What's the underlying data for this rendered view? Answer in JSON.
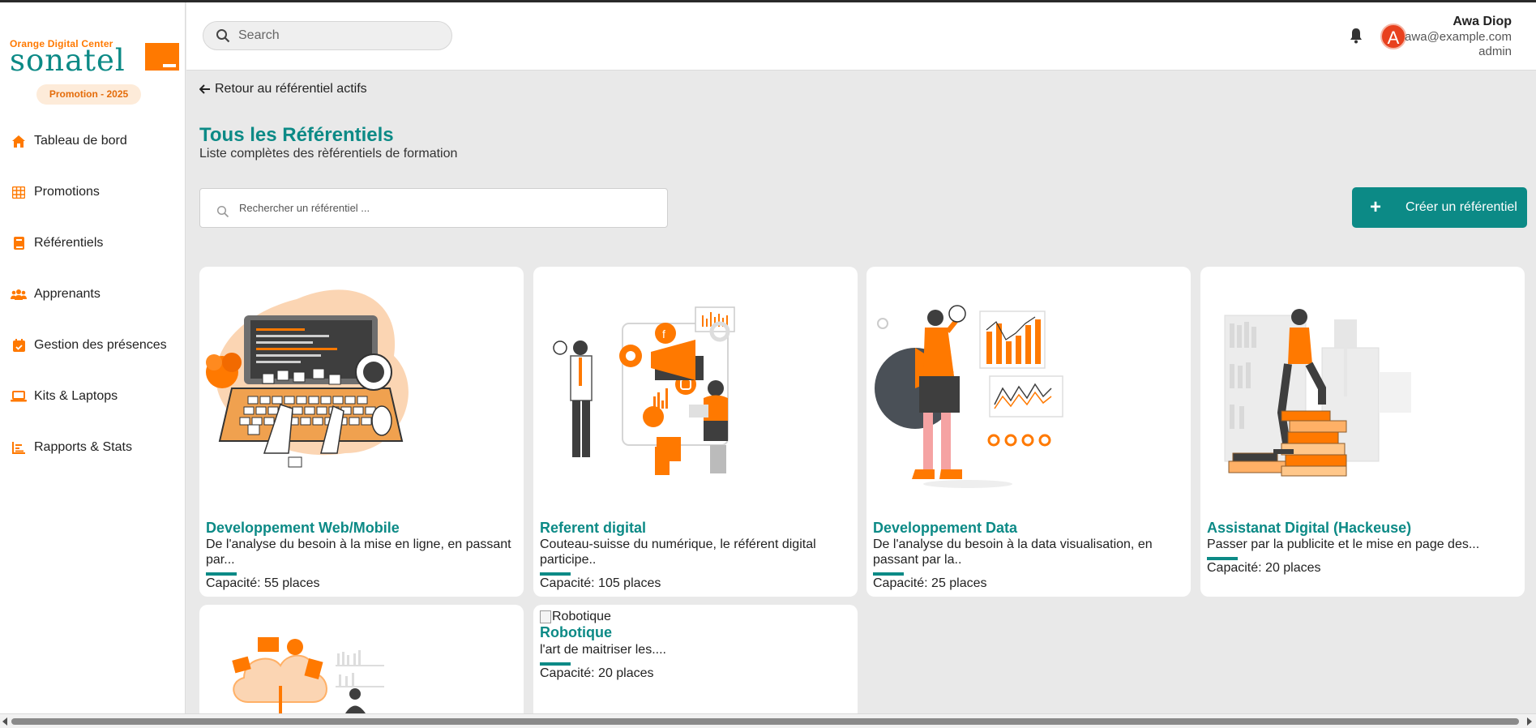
{
  "brand": {
    "top_text": "Orange Digital Center",
    "main_text": "sonatel",
    "accent": "#ff7900",
    "teal": "#0c8a86"
  },
  "sidebar": {
    "promotion_badge": "Promotion - 2025",
    "items": [
      {
        "label": "Tableau de bord",
        "icon": "home-icon"
      },
      {
        "label": "Promotions",
        "icon": "grid-icon"
      },
      {
        "label": "Référentiels",
        "icon": "book-icon"
      },
      {
        "label": "Apprenants",
        "icon": "users-icon"
      },
      {
        "label": "Gestion des présences",
        "icon": "calendar-check-icon"
      },
      {
        "label": "Kits & Laptops",
        "icon": "laptop-icon"
      },
      {
        "label": "Rapports & Stats",
        "icon": "bar-chart-icon"
      }
    ]
  },
  "header": {
    "search_placeholder": "Search",
    "user": {
      "avatar_letter": "A",
      "name": "Awa Diop",
      "email": "awa@example.com",
      "role": "admin"
    }
  },
  "main": {
    "back_link": "Retour au référentiel actifs",
    "title": "Tous les Référentiels",
    "subtitle": "Liste complètes des rèférentiels de formation",
    "search_placeholder": "Rechercher un référentiel ...",
    "create_button": "Créer un référentiel",
    "cards": [
      {
        "title": "Developpement Web/Mobile",
        "description": "De l'analyse du besoin à la mise en ligne, en passant par...",
        "capacity": "Capacité: 55 places"
      },
      {
        "title": "Referent digital",
        "description": "Couteau-suisse du numérique, le référent digital participe..",
        "capacity": "Capacité: 105 places"
      },
      {
        "title": "Developpement Data",
        "description": "De l'analyse du besoin à la data visualisation, en passant par la..",
        "capacity": "Capacité: 25 places"
      },
      {
        "title": "Assistanat Digital (Hackeuse)",
        "description": "Passer par la publicite et le mise en page des...",
        "capacity": "Capacité: 20 places"
      },
      {
        "title": "",
        "description": "",
        "capacity": ""
      },
      {
        "image_alt": "Robotique",
        "title": "Robotique",
        "description": "l'art de maitriser les....",
        "capacity": "Capacité: 20 places"
      }
    ]
  }
}
